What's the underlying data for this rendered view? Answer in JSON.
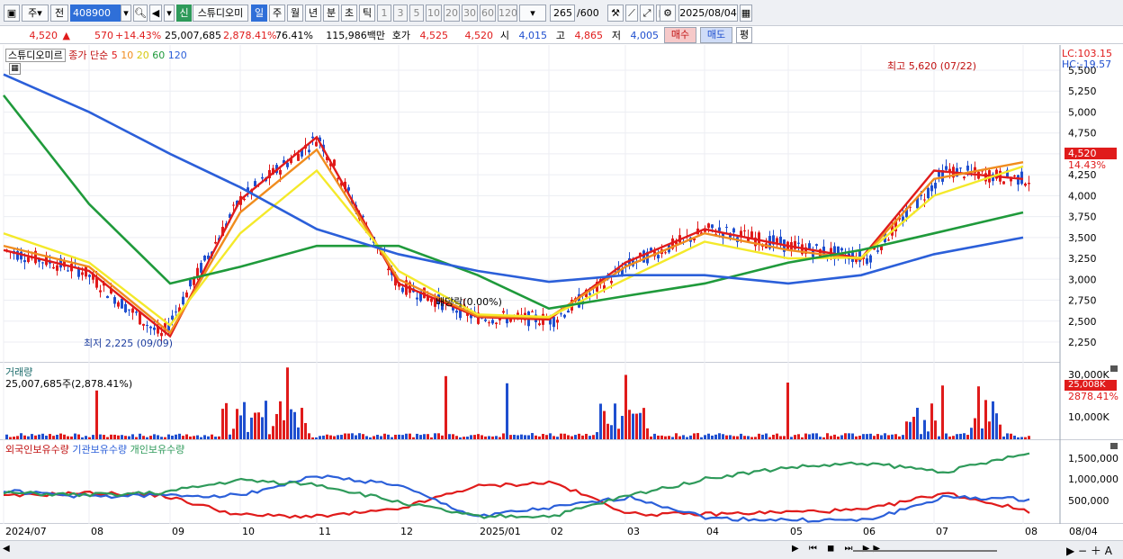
{
  "toolbar": {
    "market": "주",
    "period_prefix": "전",
    "code": "408900",
    "new_badge": "신",
    "stock_name": "스튜디오미",
    "periods": [
      "일",
      "주",
      "월",
      "년",
      "분",
      "초",
      "틱"
    ],
    "numbers": [
      "1",
      "3",
      "5",
      "10",
      "20",
      "30",
      "60",
      "120"
    ],
    "count_value": "265",
    "count_max": "/600",
    "date": "2025/08/04"
  },
  "info": {
    "price": "4,520",
    "change": "570",
    "change_pct": "+14.43%",
    "volume": "25,007,685",
    "volume_ratio": "2,878.41%",
    "turnover": "76.41%",
    "amount": "115,986백만",
    "quote_label": "호가",
    "ask": "4,525",
    "bid": "4,520",
    "open_label": "시",
    "open": "4,015",
    "high_label": "고",
    "high": "4,865",
    "low_label": "저",
    "low": "4,005",
    "buy": "매수",
    "sell": "매도",
    "avg": "평"
  },
  "legend": {
    "name": "스튜디오미르",
    "title": "종가 단순",
    "ma": [
      "5",
      "10",
      "20",
      "60",
      "120"
    ]
  },
  "annotations": {
    "high_label": "최고 5,620 (07/22)",
    "low_label": "최저 2,225 (09/09)",
    "dividend": "배당락(0.00%)"
  },
  "right": {
    "lc": "LC:103.15",
    "hc": "HC:-19.57",
    "price_tag": "4,520",
    "pct_tag": "14.43%",
    "vol_tag": "25,008K",
    "vol_pct": "2878.41%"
  },
  "price_axis": [
    "5,500",
    "5,250",
    "5,000",
    "4,750",
    "4,500",
    "4,250",
    "4,000",
    "3,750",
    "3,500",
    "3,250",
    "3,000",
    "2,750",
    "2,500",
    "2,250"
  ],
  "volume": {
    "title": "거래량",
    "value": "25,007,685주(2,878.41%)",
    "axis": [
      "30,000K",
      "10,000K"
    ]
  },
  "holdings": {
    "labels": [
      "외국인보유수량",
      "기관보유수량",
      "개인보유수량"
    ],
    "axis": [
      "1,500,000",
      "1,000,000",
      "500,000"
    ]
  },
  "xaxis": [
    "2024/07",
    "08",
    "09",
    "10",
    "11",
    "12",
    "2025/01",
    "02",
    "03",
    "04",
    "05",
    "06",
    "07",
    "08",
    "08/04"
  ],
  "colors": {
    "ma5": "#e01b1b",
    "ma10": "#f08c1e",
    "ma20": "#f4e92a",
    "ma60": "#1f9a3b",
    "ma120": "#2b5fd9",
    "up": "#e01b1b",
    "down": "#1f4fcf",
    "foreign": "#e01b1b",
    "inst": "#2b5fd9",
    "retail": "#2e9a5a"
  },
  "chart_data": {
    "type": "line",
    "title": "스튜디오미르 종가 단순",
    "x": [
      "2024/07",
      "08",
      "09",
      "10",
      "11",
      "12",
      "2025/01",
      "02",
      "03",
      "04",
      "05",
      "06",
      "07",
      "08"
    ],
    "ylim": [
      2100,
      5600
    ],
    "series": [
      {
        "name": "5",
        "values": [
          3350,
          3100,
          2320,
          3950,
          4700,
          2950,
          2550,
          2520,
          3200,
          3600,
          3400,
          3250,
          4300,
          4200
        ]
      },
      {
        "name": "10",
        "values": [
          3400,
          3150,
          2360,
          3800,
          4550,
          3000,
          2560,
          2540,
          3150,
          3550,
          3350,
          3240,
          4200,
          4400
        ]
      },
      {
        "name": "20",
        "values": [
          3550,
          3200,
          2450,
          3550,
          4300,
          3100,
          2580,
          2550,
          3000,
          3450,
          3250,
          3260,
          4000,
          4350
        ]
      },
      {
        "name": "60",
        "values": [
          5200,
          3900,
          2950,
          3150,
          3400,
          3400,
          3050,
          2650,
          2800,
          2950,
          3200,
          3350,
          3550,
          3800
        ]
      },
      {
        "name": "120",
        "values": [
          5450,
          5000,
          4500,
          4100,
          3600,
          3300,
          3100,
          2970,
          3050,
          3050,
          2950,
          3050,
          3300,
          3500
        ]
      }
    ]
  }
}
